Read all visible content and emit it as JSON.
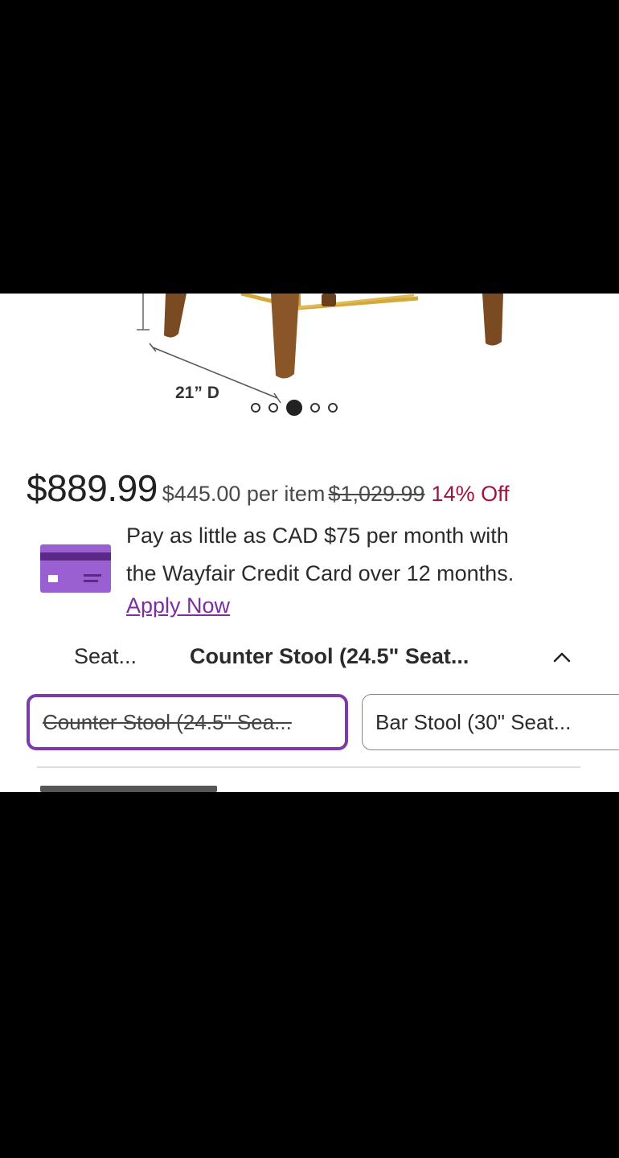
{
  "product": {
    "dimension_label": "21” D"
  },
  "carousel": {
    "count": 5,
    "active_index": 2
  },
  "pricing": {
    "sale_price": "$889.99",
    "per_item": "$445.00 per item",
    "original_price": "$1,029.99",
    "discount": "14% Off",
    "discount_color": "#a3143c"
  },
  "financing": {
    "icon": "credit-card-icon",
    "line1": "Pay as little as CAD $75 per month with",
    "line2": "the Wayfair Credit Card over 12 months.",
    "apply_label": "Apply Now",
    "accent_color": "#7b2f9e"
  },
  "options": {
    "label": "Seat...",
    "selected_value": "Counter Stool (24.5\" Seat...",
    "chevron": "chevron-up-icon",
    "choices": [
      {
        "label": "Counter Stool (24.5\" Sea...",
        "selected": true,
        "unavailable": true
      },
      {
        "label": "Bar Stool (30\" Seat...",
        "selected": false,
        "unavailable": false
      }
    ]
  }
}
